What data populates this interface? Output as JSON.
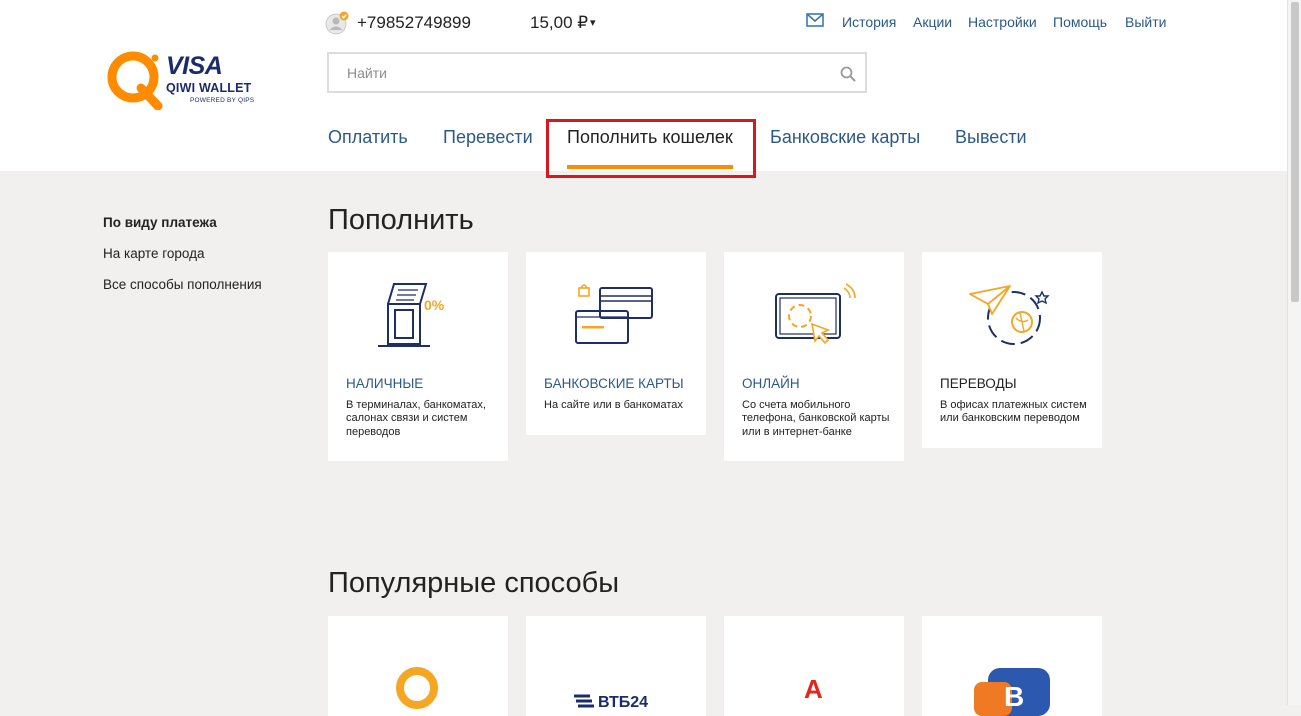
{
  "header": {
    "logo": {
      "brand": "VISA",
      "product": "QIWI WALLET",
      "tagline": "POWERED BY QIPS"
    },
    "account": {
      "phone": "+79852749899",
      "balance": "15,00 ₽",
      "balance_caret": "▾"
    },
    "top_links": [
      "История",
      "Акции",
      "Настройки",
      "Помощь",
      "Выйти"
    ],
    "search": {
      "placeholder": "Найти",
      "value": ""
    },
    "nav": {
      "items": [
        "Оплатить",
        "Перевести",
        "Пополнить кошелек",
        "Банковские карты",
        "Вывести"
      ],
      "active": "Пополнить кошелек"
    }
  },
  "sidebar": {
    "items": [
      "По виду платежа",
      "На карте города",
      "Все способы пополнения"
    ],
    "active": "По виду платежа"
  },
  "main": {
    "title": "Пополнить",
    "cards": [
      {
        "title": "НАЛИЧНЫЕ",
        "desc": "В терминалах, банкоматах, салонах связи и систем переводов",
        "icon": "terminal-icon"
      },
      {
        "title": "БАНКОВСКИЕ КАРТЫ",
        "desc": "На сайте или в банкоматах",
        "icon": "bank-cards-icon"
      },
      {
        "title": "ОНЛАЙН",
        "desc": "Со счета мобильного телефона, банковской карты или в интернет-банке",
        "icon": "online-icon"
      },
      {
        "title": "ПЕРЕВОДЫ",
        "desc": "В офисах платежных систем или банковским переводом",
        "icon": "transfers-icon"
      }
    ],
    "popular_title": "Популярные способы",
    "popular": [
      {
        "icon": "qiwi-logo-icon"
      },
      {
        "icon": "vtb24-logo-icon",
        "label": "ВТБ24"
      },
      {
        "icon": "alfa-bank-logo-icon",
        "label": "А"
      },
      {
        "icon": "bank-otkritie-logo-icon"
      }
    ]
  },
  "colors": {
    "accent": "#ff8c00",
    "link": "#2b5a86",
    "brand_navy": "#1a2c6b",
    "highlight": "#d7191f",
    "page_bg": "#f1f0ef"
  }
}
